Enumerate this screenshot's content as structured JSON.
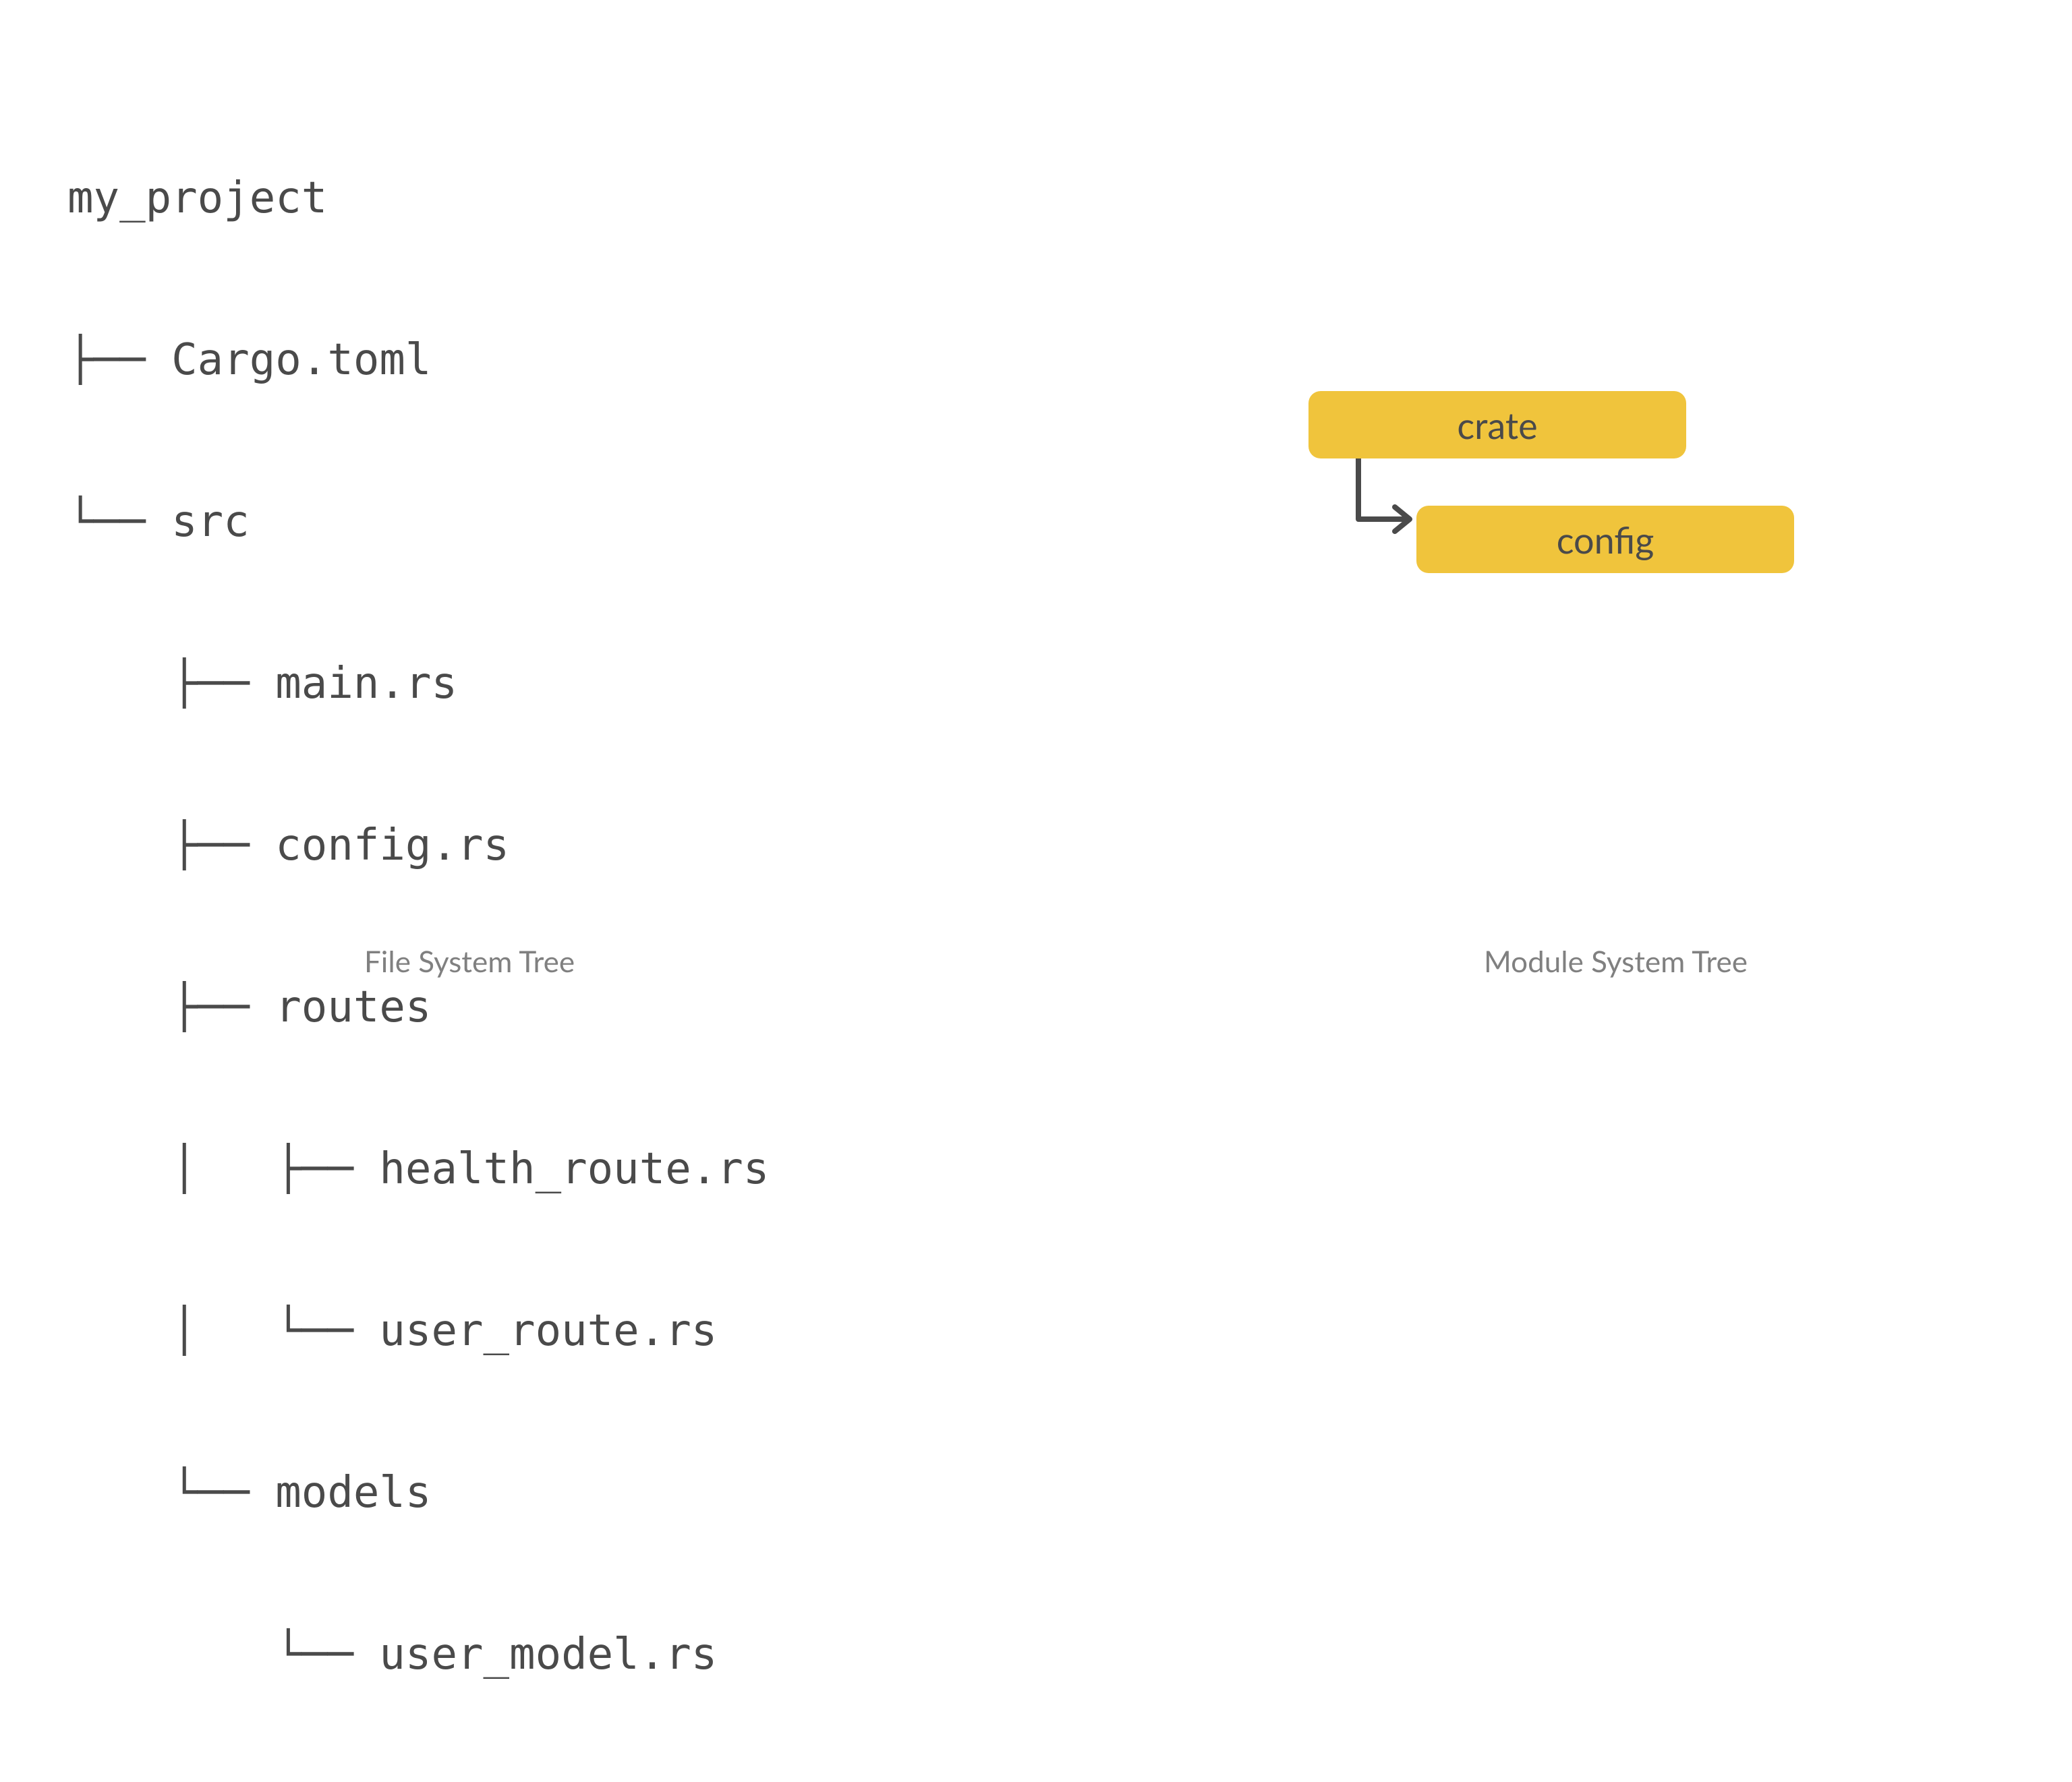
{
  "filetree": {
    "lines": [
      "my_project",
      "├── Cargo.toml",
      "└── src",
      "    ├── main.rs",
      "    ├── config.rs",
      "    ├── routes",
      "    │   ├── health_route.rs",
      "    │   └── user_route.rs",
      "    └── models",
      "        └── user_model.rs"
    ]
  },
  "captions": {
    "left": "File System Tree",
    "right": "Module System Tree"
  },
  "module_tree": {
    "root": "crate",
    "child": "config"
  },
  "colors": {
    "node_bg": "#f0c43c",
    "text": "#4a4a4a",
    "caption": "#808080",
    "stroke": "#4a4a4a"
  }
}
